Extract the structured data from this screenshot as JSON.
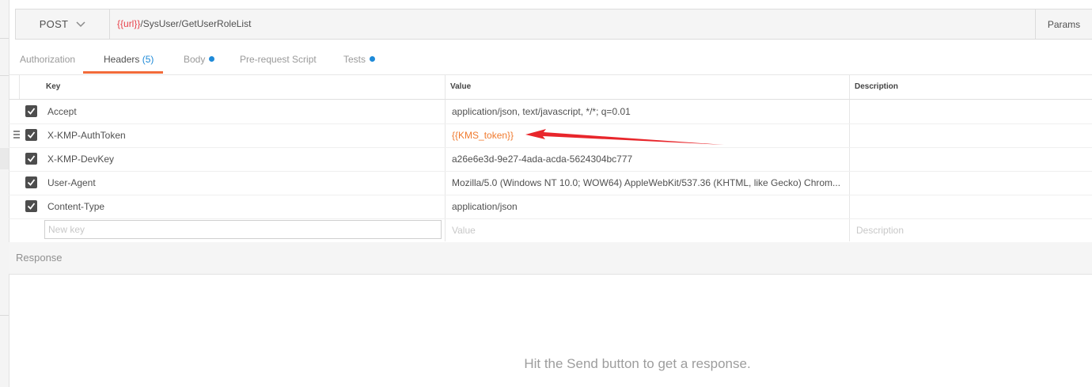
{
  "request": {
    "method": "POST",
    "url_var": "{{url}}",
    "url_path": "/SysUser/GetUserRoleList",
    "params_label": "Params"
  },
  "tabs": [
    {
      "label": "Authorization"
    },
    {
      "label": "Headers",
      "count": "(5)"
    },
    {
      "label": "Body"
    },
    {
      "label": "Pre-request Script"
    },
    {
      "label": "Tests"
    }
  ],
  "headers_table": {
    "columns": [
      "Key",
      "Value",
      "Description"
    ],
    "rows": [
      {
        "key": "Accept",
        "value": "application/json, text/javascript, */*; q=0.01",
        "description": "",
        "enabled": true
      },
      {
        "key": "X-KMP-AuthToken",
        "value": "{{KMS_token}}",
        "description": "",
        "enabled": true
      },
      {
        "key": "X-KMP-DevKey",
        "value": "a26e6e3d-9e27-4ada-acda-5624304bc777",
        "description": "",
        "enabled": true
      },
      {
        "key": "User-Agent",
        "value": "Mozilla/5.0 (Windows NT 10.0; WOW64) AppleWebKit/537.36 (KHTML, like Gecko) Chrom...",
        "description": "",
        "enabled": true
      },
      {
        "key": "Content-Type",
        "value": "application/json",
        "description": "",
        "enabled": true
      }
    ],
    "new_row": {
      "key_placeholder": "New key",
      "value_placeholder": "Value",
      "description_placeholder": "Description"
    }
  },
  "response": {
    "title": "Response",
    "empty_message": "Hit the Send button to get a response."
  },
  "colors": {
    "accent_tab": "#f26b3a",
    "variable_url": "#e8414a",
    "variable_value": "#f07a2e",
    "dot_blue": "#1e8ad8",
    "annotation_arrow": "#e8262b"
  }
}
